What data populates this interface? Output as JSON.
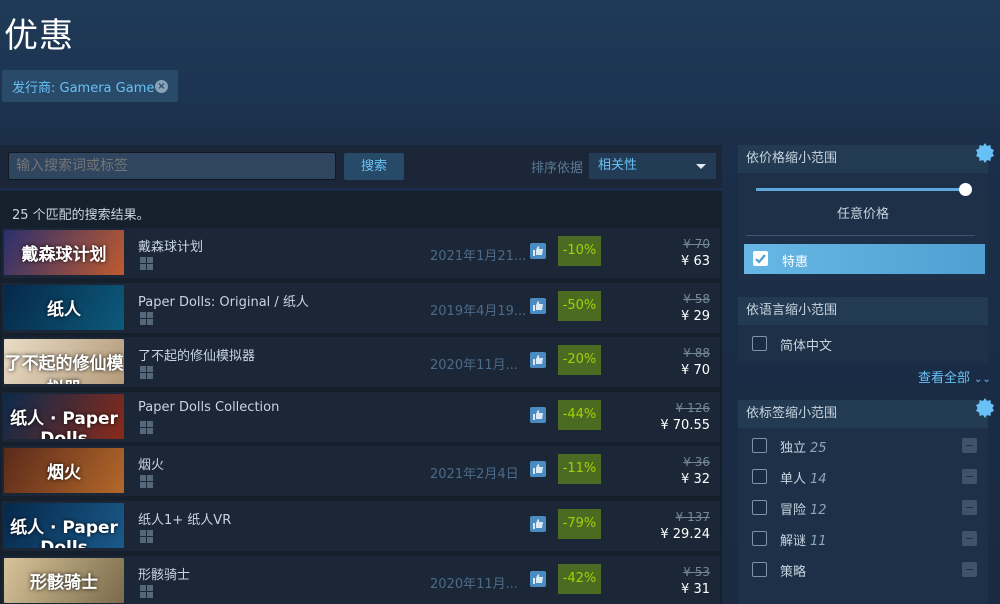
{
  "page": {
    "title": "优惠"
  },
  "filter_chip": {
    "label": "发行商: Gamera Game",
    "close_icon": "close-circle-icon"
  },
  "search": {
    "placeholder": "输入搜索词或标签",
    "button_label": "搜索",
    "sort_label": "排序依据",
    "sort_value": "相关性"
  },
  "results": {
    "count_text": "25 个匹配的搜索结果。",
    "items": [
      {
        "title": "戴森球计划",
        "capsule_text": "戴森球计划",
        "date": "2021年1月21...",
        "discount": "-10%",
        "original": "¥ 70",
        "final": "¥ 63",
        "capsule_colors": [
          "#2b2f6e",
          "#c05a2e"
        ]
      },
      {
        "title": "Paper Dolls: Original / 纸人",
        "capsule_text": "纸人",
        "date": "2019年4月19...",
        "discount": "-50%",
        "original": "¥ 58",
        "final": "¥ 29",
        "capsule_colors": [
          "#06284a",
          "#0c5a7a"
        ]
      },
      {
        "title": "了不起的修仙模拟器",
        "capsule_text": "了不起的修仙模拟器",
        "date": "2020年11月...",
        "discount": "-20%",
        "original": "¥ 88",
        "final": "¥ 70",
        "capsule_colors": [
          "#e9dcc6",
          "#b49a7a"
        ]
      },
      {
        "title": "Paper Dolls Collection",
        "capsule_text": "纸人 · Paper Dolls",
        "date": "",
        "discount": "-44%",
        "original": "¥ 126",
        "final": "¥ 70.55",
        "capsule_colors": [
          "#0a2a4c",
          "#8a2a1a"
        ]
      },
      {
        "title": "烟火",
        "capsule_text": "烟火",
        "date": "2021年2月4日",
        "discount": "-11%",
        "original": "¥ 36",
        "final": "¥ 32",
        "capsule_colors": [
          "#5a2a1a",
          "#b4682a"
        ]
      },
      {
        "title": "纸人1+ 纸人VR",
        "capsule_text": "纸人 · Paper Dolls",
        "date": "",
        "discount": "-79%",
        "original": "¥ 137",
        "final": "¥ 29.24",
        "capsule_colors": [
          "#06284a",
          "#1a5a8a"
        ]
      },
      {
        "title": "形骸骑士",
        "capsule_text": "形骸骑士",
        "date": "2020年11月...",
        "discount": "-42%",
        "original": "¥ 53",
        "final": "¥ 31",
        "capsule_colors": [
          "#d8c49a",
          "#7a6a4a"
        ]
      }
    ]
  },
  "sidebar": {
    "price": {
      "header": "依价格缩小范围",
      "label": "任意价格",
      "slider_level": 1.0,
      "special_label": "特惠"
    },
    "language": {
      "header": "依语言缩小范围",
      "option": "简体中文",
      "see_all": "查看全部"
    },
    "tags": {
      "header": "依标签缩小范围",
      "items": [
        {
          "name": "独立",
          "count": "25"
        },
        {
          "name": "单人",
          "count": "14"
        },
        {
          "name": "冒险",
          "count": "12"
        },
        {
          "name": "解谜",
          "count": "11"
        },
        {
          "name": "策略",
          "count": ""
        }
      ]
    }
  },
  "colors": {
    "accent": "#67c1f5",
    "discount_bg": "#4c6b22",
    "discount_text": "#a4d007"
  }
}
